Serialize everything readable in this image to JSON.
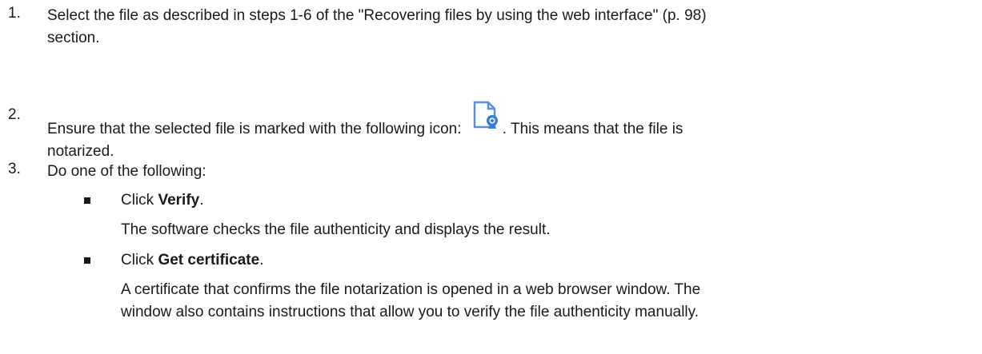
{
  "steps": [
    {
      "number": "1.",
      "line1": "Select the file as described in steps 1-6 of the \"Recovering files by using the web interface\" (p. 98)",
      "line2": "section."
    },
    {
      "number": "2.",
      "line1_before_icon": "Ensure that the selected file is marked with the following icon:",
      "icon": "notarized-file-icon",
      "line1_after_icon": ". This means that the file is",
      "line2": "notarized."
    },
    {
      "number": "3.",
      "line1": "Do one of the following:"
    }
  ],
  "options": [
    {
      "prefix": "Click ",
      "bold": "Verify",
      "suffix": ".",
      "description": "The software checks the file authenticity and displays the result."
    },
    {
      "prefix": "Click ",
      "bold": "Get certificate",
      "suffix": ".",
      "description_line1": "A certificate that confirms the file notarization is opened in a web browser window. The",
      "description_line2": "window also contains instructions that allow you to verify the file authenticity manually."
    }
  ],
  "colors": {
    "icon_blue": "#3a7bd5",
    "icon_outline": "#5a8fd8",
    "text": "#1a1a1a"
  }
}
